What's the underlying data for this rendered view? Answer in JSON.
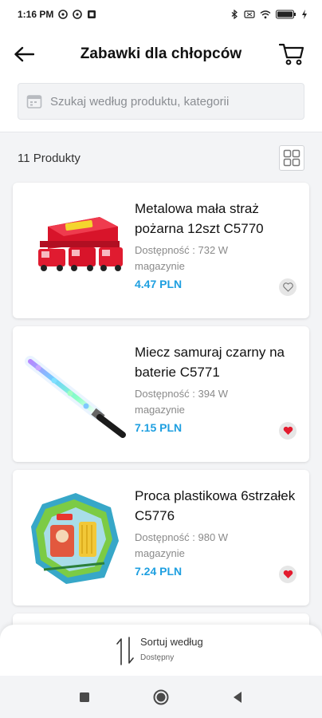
{
  "status": {
    "time": "1:16 PM",
    "battery": "100"
  },
  "header": {
    "title": "Zabawki dla chłopców"
  },
  "search": {
    "placeholder": "Szukaj według produktu, kategorii"
  },
  "listing": {
    "count_label": "11 Produkty"
  },
  "products": [
    {
      "title": "Metalowa mała straż pożarna 12szt C5770",
      "stock": "Dostępność : 732 W magazynie",
      "price": "4.47 PLN",
      "favorite": false
    },
    {
      "title": "Miecz samuraj czarny na baterie C5771",
      "stock": "Dostępność : 394 W magazynie",
      "price": "7.15 PLN",
      "favorite": true
    },
    {
      "title": "Proca plastikowa 6strzałek C5776",
      "stock": "Dostępność : 980 W magazynie",
      "price": "7.24 PLN",
      "favorite": true
    }
  ],
  "sort": {
    "label": "Sortuj według",
    "value": "Dostępny"
  },
  "colors": {
    "price": "#1e9fe0",
    "favorite_active": "#e31b2e"
  }
}
